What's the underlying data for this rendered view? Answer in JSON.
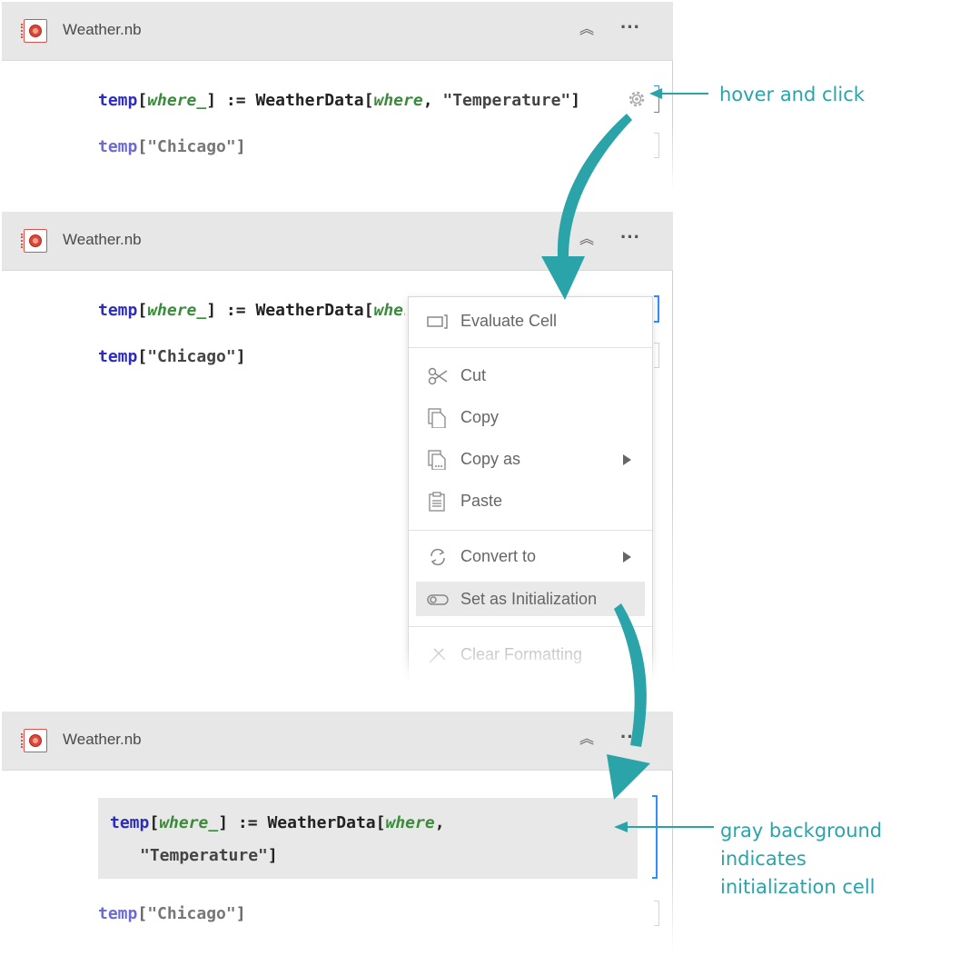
{
  "notebook": {
    "title": "Weather.nb"
  },
  "code": {
    "line1": {
      "fn": "temp",
      "open": "[",
      "param": "where_",
      "close": "]",
      "assign": " := ",
      "call": "WeatherData",
      "call_open": "[",
      "arg": "where",
      "comma": ", ",
      "str": "\"Temperature\"",
      "call_close": "]"
    },
    "line2": {
      "fn": "temp",
      "open": "[",
      "str": "\"Chicago\"",
      "close": "]"
    }
  },
  "menu": {
    "items": [
      {
        "label": "Evaluate Cell",
        "icon": "evaluate-cell-icon"
      },
      {
        "label": "Cut",
        "icon": "scissors-icon"
      },
      {
        "label": "Copy",
        "icon": "copy-icon"
      },
      {
        "label": "Copy as",
        "icon": "copy-as-icon",
        "submenu": true
      },
      {
        "label": "Paste",
        "icon": "paste-icon"
      },
      {
        "label": "Convert to",
        "icon": "convert-icon",
        "submenu": true
      },
      {
        "label": "Set as Initialization",
        "icon": "initialization-icon",
        "highlighted": true
      },
      {
        "label": "Clear Formatting",
        "icon": "clear-formatting-icon"
      }
    ]
  },
  "annotations": {
    "hover_click": "hover  and click",
    "gray_bg_line1": "gray background indicates",
    "gray_bg_line2": "initialization cell"
  },
  "colors": {
    "accent": "#2aa4a8",
    "cell_bracket_selected": "#2f8fff",
    "titlebar": "#e7e7e7",
    "init_background": "#e8e8e8"
  }
}
